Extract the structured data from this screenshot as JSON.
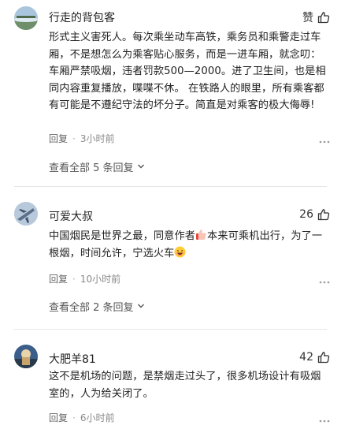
{
  "comments": [
    {
      "username": "行走的背包客",
      "like_label": "赞",
      "content": "形式主义害死人。每次乘坐动车高铁，乘务员和乘警走过车厢，不是想怎么为乘客贴心服务，而是一进车厢，就念叨：车厢严禁吸烟，违者罚款500—2000。进了卫生间，也是相同内容重复播放，喋喋不休。 在铁路人的眼里，所有乘客都有可能是不遵纪守法的坏分子。简直是对乘客的极大侮辱!",
      "reply_label": "回复",
      "time": "3小时前",
      "view_replies": "查看全部 5 条回复"
    },
    {
      "username": "可爱大叔",
      "like_count": "26",
      "content_before": "中国烟民是世界之最，同意作者",
      "content_middle": "本来可乘机出行，为了一根烟，时间允许，宁选火车",
      "reply_label": "回复",
      "time": "10小时前",
      "view_replies": "查看全部 2 条回复"
    },
    {
      "username": "大肥羊81",
      "like_count": "42",
      "content": "这不是机场的问题，是禁烟走过头了，很多机场设计有吸烟室的，人为给关闭了。",
      "reply_label": "回复",
      "time": "6小时前"
    }
  ],
  "icons": {
    "like": "thumbs-up-icon",
    "more": "more-dots-icon",
    "expand": "chevron-down-icon"
  }
}
